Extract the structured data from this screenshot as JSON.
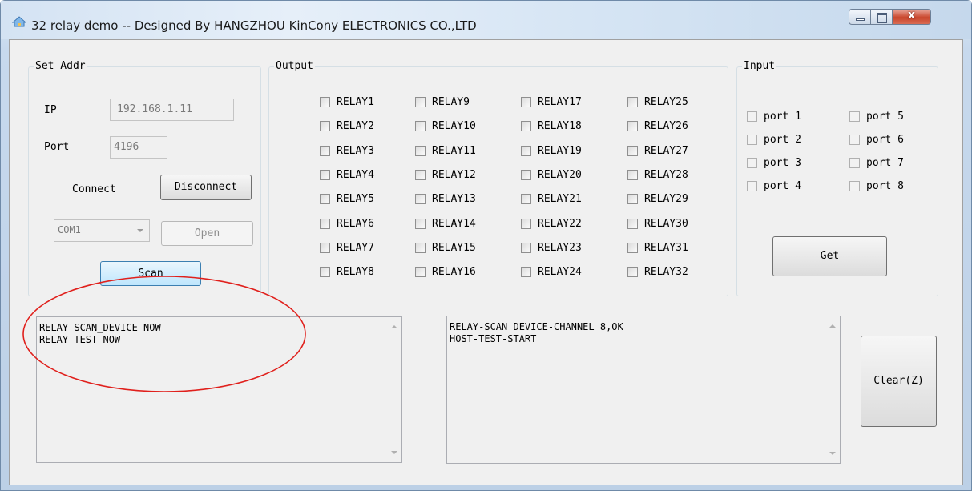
{
  "window": {
    "title": "32 relay demo -- Designed By HANGZHOU KinCony ELECTRONICS CO.,LTD",
    "close_glyph": "x",
    "icon": "app-icon"
  },
  "set_addr": {
    "legend": "Set Addr",
    "ip_label": "IP",
    "ip_value": "192.168.1.11",
    "port_label": "Port",
    "port_value": "4196",
    "connect_label": "Connect",
    "disconnect_button": "Disconnect",
    "com_value": "COM1",
    "open_button": "Open",
    "scan_button": "Scan"
  },
  "output": {
    "legend": "Output",
    "relays": [
      "RELAY1",
      "RELAY2",
      "RELAY3",
      "RELAY4",
      "RELAY5",
      "RELAY6",
      "RELAY7",
      "RELAY8",
      "RELAY9",
      "RELAY10",
      "RELAY11",
      "RELAY12",
      "RELAY13",
      "RELAY14",
      "RELAY15",
      "RELAY16",
      "RELAY17",
      "RELAY18",
      "RELAY19",
      "RELAY20",
      "RELAY21",
      "RELAY22",
      "RELAY23",
      "RELAY24",
      "RELAY25",
      "RELAY26",
      "RELAY27",
      "RELAY28",
      "RELAY29",
      "RELAY30",
      "RELAY31",
      "RELAY32"
    ]
  },
  "input": {
    "legend": "Input",
    "ports": [
      "port 1",
      "port 2",
      "port 3",
      "port 4",
      "port 5",
      "port 6",
      "port 7",
      "port 8"
    ],
    "get_button": "Get"
  },
  "log_left": "RELAY-SCAN_DEVICE-NOW\nRELAY-TEST-NOW",
  "log_right": "RELAY-SCAN_DEVICE-CHANNEL_8,OK\nHOST-TEST-START",
  "clear_button": "Clear(Z)",
  "colors": {
    "annotation": "#e0201c",
    "close_button": "#c9462c",
    "frame": "#bcd0e6"
  }
}
